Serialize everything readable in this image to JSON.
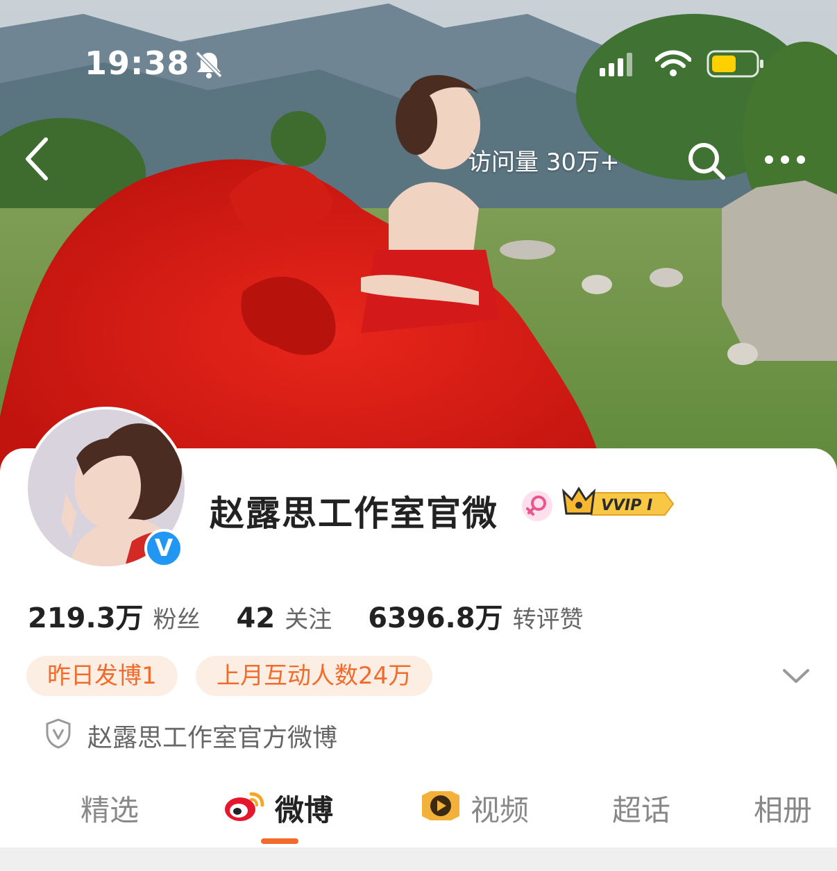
{
  "status_bar": {
    "time": "19:38",
    "icons": [
      "bell-slash-icon",
      "cellular-signal-icon",
      "wifi-icon",
      "battery-icon"
    ]
  },
  "nav": {
    "visit_count": "访问量 30万+",
    "icons": [
      "back-icon",
      "search-icon",
      "more-icon"
    ]
  },
  "profile": {
    "name": "赵露思工作室官微",
    "vvip_label": "VVIP I",
    "stats": [
      {
        "value": "219.3万",
        "label": "粉丝"
      },
      {
        "value": "42",
        "label": "关注"
      },
      {
        "value": "6396.8万",
        "label": "转评赞"
      }
    ],
    "tags": [
      "昨日发博1",
      "上月互动人数24万"
    ],
    "verification": "赵露思工作室官方微博"
  },
  "tabs": [
    {
      "label": "精选",
      "active": false
    },
    {
      "label": "微博",
      "active": true,
      "icon": "weibo-logo-icon"
    },
    {
      "label": "视频",
      "active": false,
      "icon": "video-play-icon"
    },
    {
      "label": "超话",
      "active": false
    },
    {
      "label": "相册",
      "active": false
    }
  ],
  "colors": {
    "accent": "#f26b2b",
    "tag_bg": "#fdeee4",
    "verified_blue": "#2196f3",
    "vvip_gold": "#f5b82e"
  }
}
